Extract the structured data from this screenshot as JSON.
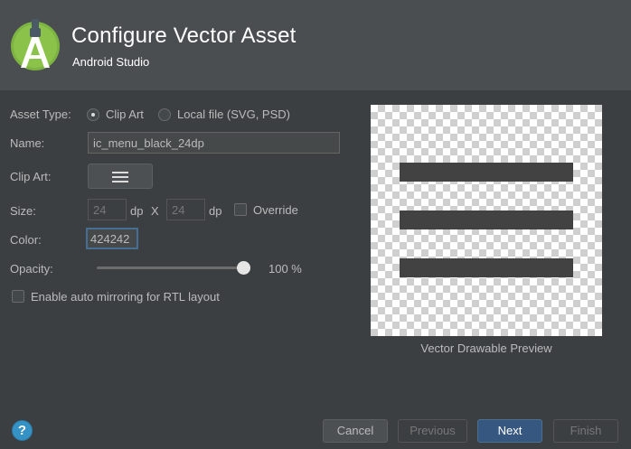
{
  "header": {
    "title": "Configure Vector Asset",
    "subtitle": "Android Studio",
    "logo_icon": "android-studio-logo-icon"
  },
  "form": {
    "asset_type": {
      "label": "Asset Type:",
      "options": [
        "Clip Art",
        "Local file (SVG, PSD)"
      ],
      "selected": "Clip Art"
    },
    "name": {
      "label": "Name:",
      "value": "ic_menu_black_24dp"
    },
    "clip_art": {
      "label": "Clip Art:",
      "icon": "hamburger-menu-icon"
    },
    "size": {
      "label": "Size:",
      "width": "24",
      "height": "24",
      "unit": "dp",
      "separator": "X",
      "override_label": "Override",
      "override_checked": false
    },
    "color": {
      "label": "Color:",
      "value": "424242"
    },
    "opacity": {
      "label": "Opacity:",
      "value_text": "100 %",
      "level": 100
    },
    "rtl": {
      "label": "Enable auto mirroring for RTL layout",
      "checked": false
    }
  },
  "preview": {
    "caption": "Vector Drawable Preview",
    "icon": "hamburger-menu-icon",
    "fill_color": "#424242"
  },
  "footer": {
    "help": "?",
    "cancel": "Cancel",
    "previous": "Previous",
    "next": "Next",
    "finish": "Finish"
  },
  "colors": {
    "background": "#3c3f41",
    "header": "#4b4e50",
    "accent": "#365880",
    "help_blue": "#3592c4"
  }
}
